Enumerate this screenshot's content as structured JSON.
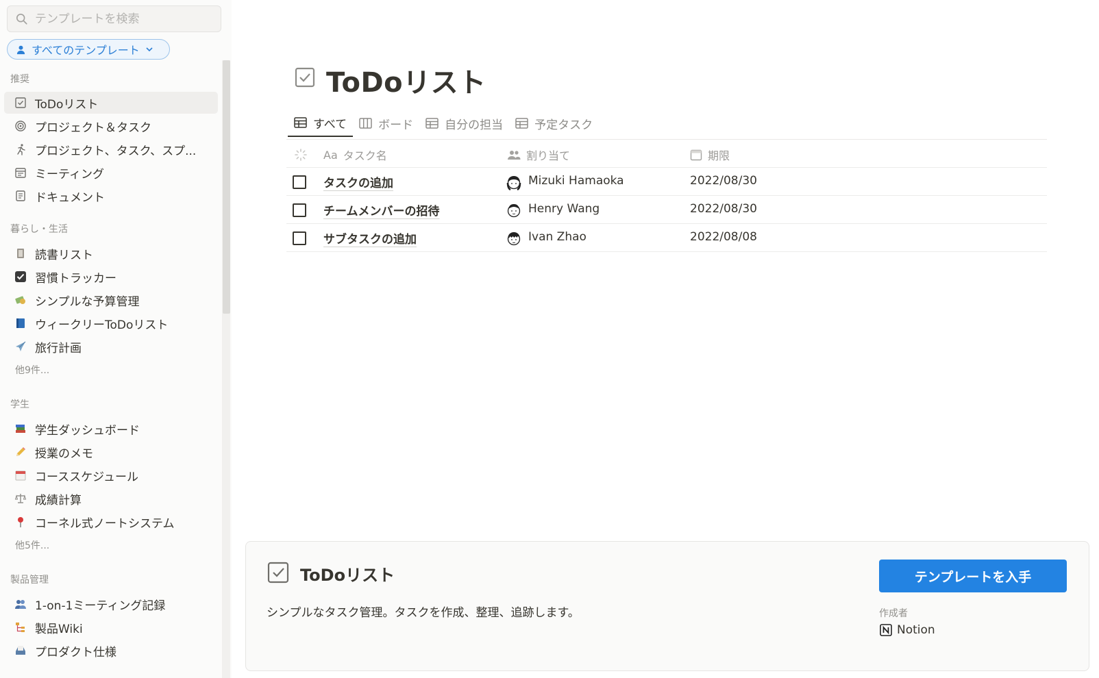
{
  "sidebar": {
    "search_placeholder": "テンプレートを検索",
    "filter_label": "すべてのテンプレート",
    "sections": [
      {
        "title": "推奨",
        "items": [
          {
            "label": "ToDoリスト",
            "icon": "checkbox-icon"
          },
          {
            "label": "プロジェクト＆タスク",
            "icon": "target-icon"
          },
          {
            "label": "プロジェクト、タスク、スプ...",
            "icon": "runner-icon"
          },
          {
            "label": "ミーティング",
            "icon": "calendar-icon"
          },
          {
            "label": "ドキュメント",
            "icon": "document-icon"
          }
        ]
      },
      {
        "title": "暮らし・生活",
        "items": [
          {
            "label": "読書リスト",
            "icon": "book-icon"
          },
          {
            "label": "習慣トラッカー",
            "icon": "check-box-filled-icon"
          },
          {
            "label": "シンプルな予算管理",
            "icon": "money-icon"
          },
          {
            "label": "ウィークリーToDoリスト",
            "icon": "blue-book-icon"
          },
          {
            "label": "旅行計画",
            "icon": "airplane-icon"
          }
        ],
        "more": "他9件..."
      },
      {
        "title": "学生",
        "items": [
          {
            "label": "学生ダッシュボード",
            "icon": "books-icon"
          },
          {
            "label": "授業のメモ",
            "icon": "pencil-icon"
          },
          {
            "label": "コーススケジュール",
            "icon": "calendar-page-icon"
          },
          {
            "label": "成績計算",
            "icon": "scale-icon"
          },
          {
            "label": "コーネル式ノートシステム",
            "icon": "pin-icon"
          }
        ],
        "more": "他5件..."
      },
      {
        "title": "製品管理",
        "items": [
          {
            "label": "1-on-1ミーティング記録",
            "icon": "people-icon"
          },
          {
            "label": "製品Wiki",
            "icon": "sitemap-icon"
          },
          {
            "label": "プロダクト仕様",
            "icon": "tray-icon"
          }
        ]
      }
    ]
  },
  "main": {
    "title": "ToDoリスト",
    "tabs": [
      {
        "label": "すべて",
        "active": true
      },
      {
        "label": "ボード",
        "active": false
      },
      {
        "label": "自分の担当",
        "active": false
      },
      {
        "label": "予定タスク",
        "active": false
      }
    ],
    "table": {
      "columns": [
        "タスク名",
        "割り当て",
        "期限"
      ],
      "column_prefix": "Aa",
      "rows": [
        {
          "name": "タスクの追加",
          "assignee": "Mizuki Hamaoka",
          "due": "2022/08/30"
        },
        {
          "name": "チームメンバーの招待",
          "assignee": "Henry Wang",
          "due": "2022/08/30"
        },
        {
          "name": "サブタスクの追加",
          "assignee": "Ivan Zhao",
          "due": "2022/08/08"
        }
      ]
    }
  },
  "panel": {
    "title": "ToDoリスト",
    "description": "シンプルなタスク管理。タスクを作成、整理、追跡します。",
    "button_label": "テンプレートを入手",
    "author_label": "作成者",
    "author_name": "Notion"
  },
  "colors": {
    "accent": "#2383e2",
    "filter_blue": "#2b7fd6",
    "text": "#37352f"
  }
}
